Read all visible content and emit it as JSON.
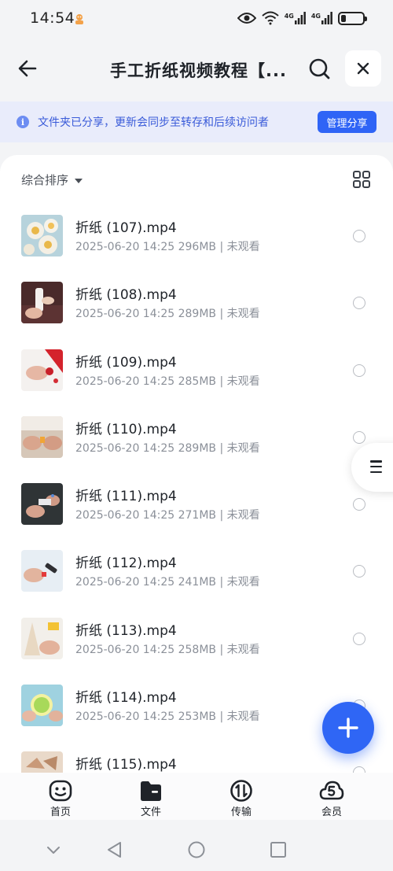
{
  "status_bar": {
    "time": "14:54",
    "network_left": "4G",
    "network_right": "4G"
  },
  "header": {
    "title": "手工折纸视频教程【..."
  },
  "notice": {
    "icon_char": "i",
    "text": "文件夹已分享，更新会同步至转存和后续访问者",
    "button_label": "管理分享"
  },
  "toolbar": {
    "sort_label": "综合排序"
  },
  "files": [
    {
      "name": "折纸 (107).mp4",
      "meta": "2025-06-20 14:25  296MB | 未观看"
    },
    {
      "name": "折纸 (108).mp4",
      "meta": "2025-06-20 14:25  289MB | 未观看"
    },
    {
      "name": "折纸 (109).mp4",
      "meta": "2025-06-20 14:25  285MB | 未观看"
    },
    {
      "name": "折纸 (110).mp4",
      "meta": "2025-06-20 14:25  289MB | 未观看"
    },
    {
      "name": "折纸 (111).mp4",
      "meta": "2025-06-20 14:25  271MB | 未观看"
    },
    {
      "name": "折纸 (112).mp4",
      "meta": "2025-06-20 14:25  241MB | 未观看"
    },
    {
      "name": "折纸 (113).mp4",
      "meta": "2025-06-20 14:25  258MB | 未观看"
    },
    {
      "name": "折纸 (114).mp4",
      "meta": "2025-06-20 14:25  253MB | 未观看"
    },
    {
      "name": "折纸 (115).mp4",
      "meta": ""
    }
  ],
  "bottom_nav": {
    "home": "首页",
    "files": "文件",
    "transfer": "传输",
    "vip": "会员"
  },
  "colors": {
    "accent": "#2f64f6",
    "notice_bg": "#e9ecfb",
    "notice_text": "#3a5bd9"
  }
}
